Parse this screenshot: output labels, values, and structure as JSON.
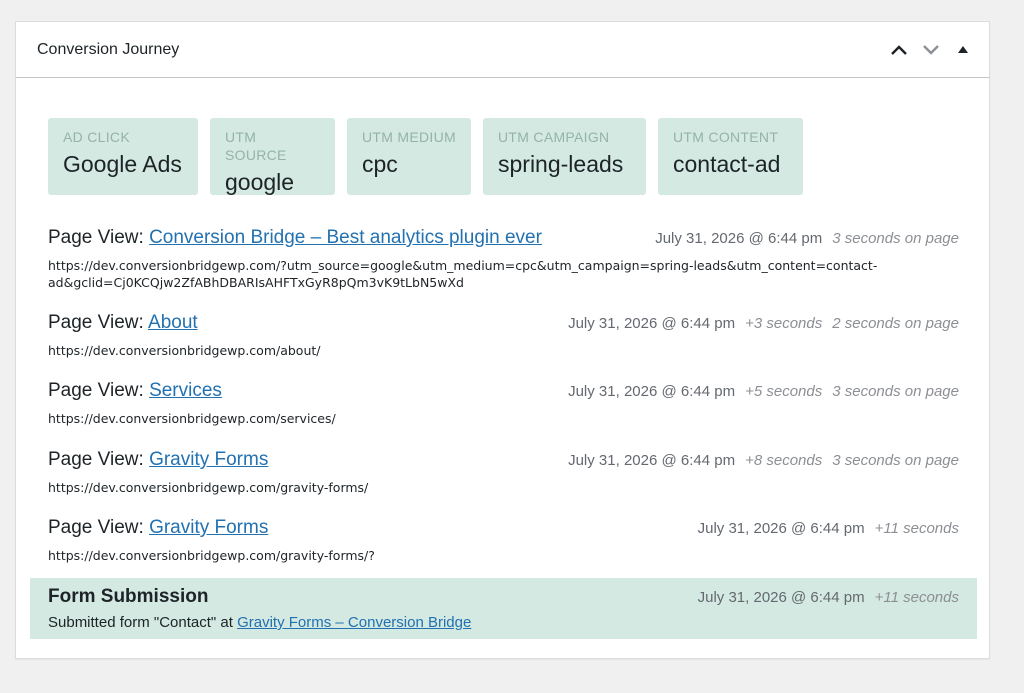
{
  "panel": {
    "title": "Conversion Journey",
    "controls": [
      {
        "name": "move-up",
        "icon": "chevron-up-icon"
      },
      {
        "name": "move-down",
        "icon": "chevron-down-icon"
      },
      {
        "name": "toggle",
        "icon": "triangle-up-icon"
      }
    ]
  },
  "tags": [
    {
      "label": "AD CLICK",
      "value": "Google Ads"
    },
    {
      "label": "UTM SOURCE",
      "value": "google"
    },
    {
      "label": "UTM MEDIUM",
      "value": "cpc"
    },
    {
      "label": "UTM CAMPAIGN",
      "value": "spring-leads"
    },
    {
      "label": "UTM CONTENT",
      "value": "contact-ad"
    }
  ],
  "page_views": [
    {
      "prefix": "Page View:",
      "title": "Conversion Bridge – Best analytics plugin ever",
      "time": "July 31, 2026 @ 6:44 pm",
      "offset": "",
      "duration": "3 seconds on page",
      "url": "https://dev.conversionbridgewp.com/?utm_source=google&utm_medium=cpc&utm_campaign=spring-leads&utm_content=contact-ad&gclid=Cj0KCQjw2ZfABhDBARIsAHFTxGyR8pQm3vK9tLbN5wXd"
    },
    {
      "prefix": "Page View:",
      "title": "About",
      "time": "July 31, 2026 @ 6:44 pm",
      "offset": "+3 seconds",
      "duration": "2 seconds on page",
      "url": "https://dev.conversionbridgewp.com/about/"
    },
    {
      "prefix": "Page View:",
      "title": "Services",
      "time": "July 31, 2026 @ 6:44 pm",
      "offset": "+5 seconds",
      "duration": "3 seconds on page",
      "url": "https://dev.conversionbridgewp.com/services/"
    },
    {
      "prefix": "Page View:",
      "title": "Gravity Forms",
      "time": "July 31, 2026 @ 6:44 pm",
      "offset": "+8 seconds",
      "duration": "3 seconds on page",
      "url": "https://dev.conversionbridgewp.com/gravity-forms/"
    },
    {
      "prefix": "Page View:",
      "title": "Gravity Forms",
      "time": "July 31, 2026 @ 6:44 pm",
      "offset": "+11 seconds",
      "duration": "",
      "url": "https://dev.conversionbridgewp.com/gravity-forms/?"
    }
  ],
  "submission": {
    "title": "Form Submission",
    "time": "July 31, 2026 @ 6:44 pm",
    "offset": "+11 seconds",
    "text_prefix": "Submitted form \"Contact\" at",
    "link": "Gravity Forms – Conversion Bridge"
  },
  "colors": {
    "accent_link": "#2271b1",
    "tag_bg": "#d3e9e1",
    "tag_label": "#95b3a8"
  }
}
